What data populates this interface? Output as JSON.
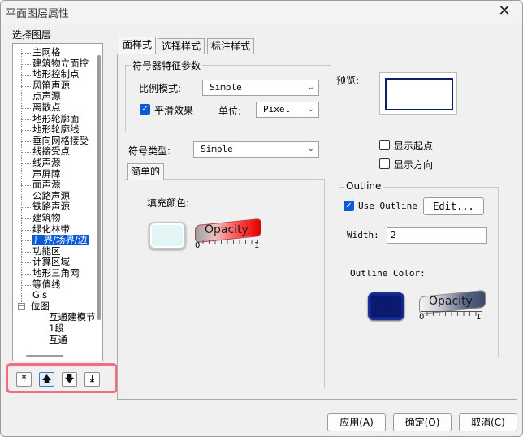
{
  "window": {
    "title": "平面图层属性",
    "close_icon": "close-icon"
  },
  "left": {
    "label": "选择图层",
    "layers": [
      "主网格",
      "建筑物立面控",
      "地形控制点",
      "风笛声源",
      "点声源",
      "离散点",
      "地形轮廓面",
      "地形轮廓线",
      "垂向网格接受",
      "线接受点",
      "线声源",
      "声屏障",
      "面声源",
      "公路声源",
      "铁路声源",
      "建筑物",
      "绿化林带",
      "厂界/场界/边",
      "功能区",
      "计算区域",
      "地形三角网",
      "等值线",
      "Gis",
      "位图",
      "互通建模节",
      "1段",
      "互通"
    ],
    "selected_index": 17,
    "move_buttons": {
      "top": "move-top-icon",
      "up": "move-up-icon",
      "down": "move-down-icon",
      "bottom": "move-bottom-icon"
    }
  },
  "tabs": [
    "面样式",
    "选择样式",
    "标注样式"
  ],
  "symbol_params": {
    "title": "符号器特征参数",
    "scale_mode_label": "比例模式:",
    "scale_mode_value": "Simple",
    "smooth_label": "平滑效果",
    "smooth_checked": true,
    "unit_label": "单位:",
    "unit_value": "Pixel",
    "preview_label": "预览:"
  },
  "symbol_type": {
    "label": "符号类型:",
    "value": "Simple",
    "show_start_label": "显示起点",
    "show_direction_label": "显示方向"
  },
  "simple_tab": {
    "label": "简单的",
    "fill_color_label": "填充颜色:"
  },
  "fill_opacity": {
    "text": "Opacity",
    "min": "0",
    "max": "1"
  },
  "outline": {
    "title": "Outline",
    "use_outline_label": "Use Outline",
    "use_outline_checked": true,
    "edit_label": "Edit...",
    "width_label": "Width:",
    "width_value": "2",
    "color_label": "Outline Color:",
    "opacity_text": "Opacity",
    "opacity_min": "0",
    "opacity_max": "1"
  },
  "colors": {
    "fill": "#e3f6f6",
    "outline": "#0a1a6e",
    "selection": "#0a5bd6"
  },
  "footer": {
    "apply": "应用(A)",
    "ok": "确定(O)",
    "cancel": "取消(C)"
  }
}
